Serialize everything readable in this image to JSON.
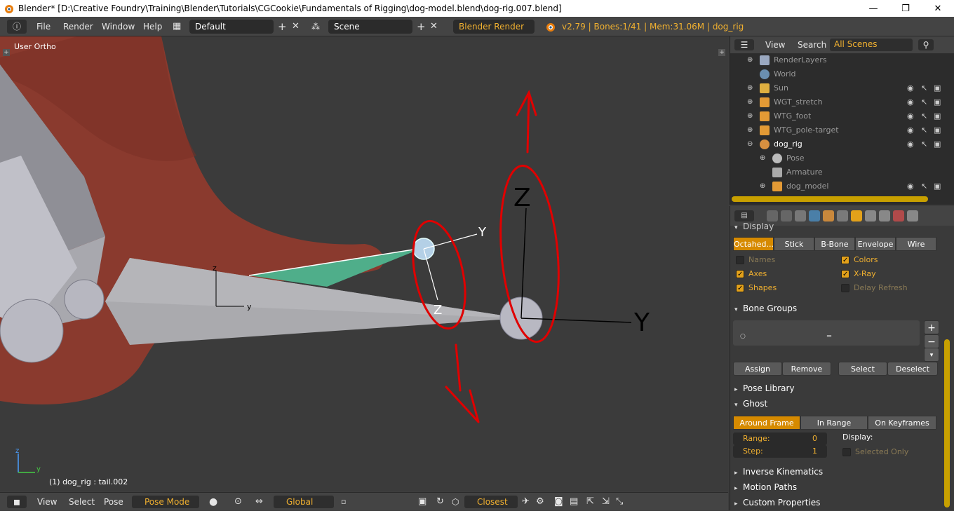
{
  "window": {
    "title": "Blender* [D:\\Creative Foundry\\Training\\Blender\\Tutorials\\CGCookie\\Fundamentals of Rigging\\dog-model.blend\\dog-rig.007.blend]",
    "minimize": "—",
    "maximize": "❐",
    "close": "✕"
  },
  "topbar": {
    "menu": [
      "File",
      "Render",
      "Window",
      "Help"
    ],
    "layout": "Default",
    "scene": "Scene",
    "engine": "Blender Render",
    "info": "v2.79 | Bones:1/41  | Mem:31.06M | dog_rig"
  },
  "viewport": {
    "view_label": "User Ortho",
    "status": "(1) dog_rig : tail.002",
    "axis_labels": {
      "y1": "Y",
      "z1": "Z",
      "y2": "Y",
      "z2": "Z",
      "y3": "y",
      "z3": "z"
    },
    "mini_axis": {
      "z": "z",
      "y": "y"
    }
  },
  "bottombar": {
    "menu": [
      "View",
      "Select",
      "Pose"
    ],
    "mode": "Pose Mode",
    "orientation": "Global",
    "snap": "Closest"
  },
  "outliner": {
    "header": {
      "view": "View",
      "search": "Search",
      "scope": "All Scenes"
    },
    "rows": [
      {
        "name": "RenderLayers",
        "icon": "render-layers-icon",
        "exp": "+",
        "indent": 0
      },
      {
        "name": "World",
        "icon": "world-icon",
        "exp": "",
        "indent": 0
      },
      {
        "name": "Sun",
        "icon": "lamp-icon",
        "exp": "+",
        "indent": 0
      },
      {
        "name": "WGT_stretch",
        "icon": "mesh-icon",
        "exp": "+",
        "indent": 0
      },
      {
        "name": "WTG_foot",
        "icon": "mesh-icon",
        "exp": "+",
        "indent": 0
      },
      {
        "name": "WTG_pole-target",
        "icon": "mesh-icon",
        "exp": "+",
        "indent": 0
      },
      {
        "name": "dog_rig",
        "icon": "armature-icon",
        "exp": "−",
        "indent": 0
      },
      {
        "name": "Pose",
        "icon": "pose-icon",
        "exp": "+",
        "indent": 1
      },
      {
        "name": "Armature",
        "icon": "armature-data-icon",
        "exp": "",
        "indent": 1
      },
      {
        "name": "dog_model",
        "icon": "mesh-icon",
        "exp": "+",
        "indent": 1
      }
    ]
  },
  "props": {
    "display": {
      "title": "Display",
      "types": [
        "Octahed...",
        "Stick",
        "B-Bone",
        "Envelope",
        "Wire"
      ],
      "names": "Names",
      "colors": "Colors",
      "axes": "Axes",
      "xray": "X-Ray",
      "shapes": "Shapes",
      "delay_refresh": "Delay Refresh"
    },
    "bone_groups": {
      "title": "Bone Groups",
      "assign": "Assign",
      "remove": "Remove",
      "select": "Select",
      "deselect": "Deselect"
    },
    "pose_library": "Pose Library",
    "ghost": {
      "title": "Ghost",
      "types": [
        "Around Frame",
        "In Range",
        "On Keyframes"
      ],
      "range_label": "Range:",
      "range_value": "0",
      "step_label": "Step:",
      "step_value": "1",
      "display_label": "Display:",
      "selected_only": "Selected Only"
    },
    "ik": "Inverse Kinematics",
    "motion_paths": "Motion Paths",
    "custom_props": "Custom Properties"
  },
  "colors": {
    "accent": "#d68a00",
    "dog_body": "#8a3a2e",
    "annotation": "#e00000",
    "bone": "#a6a6a6",
    "selected_bone": "#4fae8a"
  }
}
